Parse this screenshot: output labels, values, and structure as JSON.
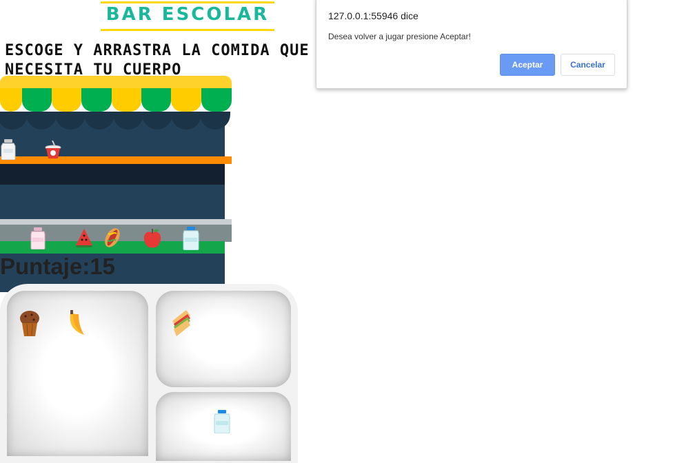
{
  "header": {
    "title": "BAR ESCOLAR"
  },
  "instruction": "ESCOGE Y ARRASTRA LA COMIDA QUE\nNECESITA TU CUERPO",
  "score": {
    "label": "Puntaje:",
    "value": "15"
  },
  "shop": {
    "shelf_items": [
      "milk-bottle",
      "yogurt-cup"
    ],
    "counter_items": [
      "strawberry-milk-bottle",
      "watermelon-slice",
      "hot-dog",
      "apple",
      "water-bottle"
    ]
  },
  "tray": {
    "left_items": [
      "muffin",
      "banana"
    ],
    "top_right_items": [
      "sandwich"
    ],
    "bottom_right_items": [
      "water-bottle"
    ]
  },
  "dialog": {
    "title": "127.0.0.1:55946 dice",
    "message": "Desea volver a jugar presione Aceptar!",
    "ok_label": "Aceptar",
    "cancel_label": "Cancelar"
  },
  "colors": {
    "title": "#19b89a",
    "awning_yellow": "#ffcc00",
    "awning_green": "#00b050",
    "wall": "#24415a",
    "shelf": "#ff8c00",
    "ok_button": "#6a9bf4"
  }
}
